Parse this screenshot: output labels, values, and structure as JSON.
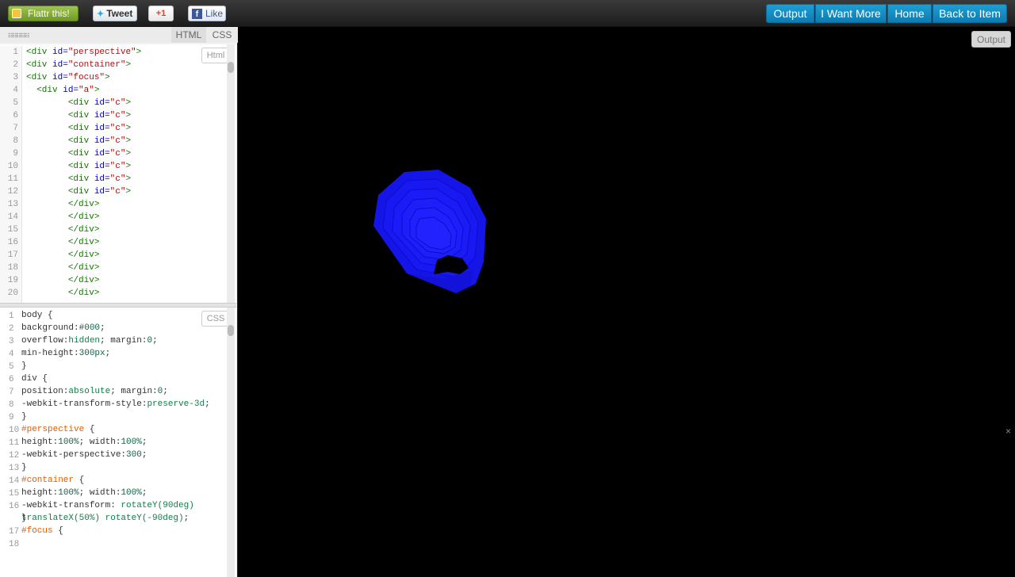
{
  "topbar": {
    "flattr_label": "Flattr this!",
    "tweet_label": "Tweet",
    "gplus_label": "+1",
    "fblike_label": "Like",
    "nav": [
      "Output",
      "I Want More",
      "Home",
      "Back to Item"
    ]
  },
  "editor": {
    "tabs": {
      "html": "HTML",
      "css": "CSS"
    },
    "html_badge": "Html",
    "css_badge": "CSS"
  },
  "html_code": [
    {
      "n": "1",
      "t": [
        [
          "tg",
          "<div "
        ],
        [
          "at",
          "id="
        ],
        [
          "st",
          "\"perspective\""
        ],
        [
          "tg",
          ">"
        ]
      ]
    },
    {
      "n": "2",
      "t": [
        [
          "tg",
          "<div "
        ],
        [
          "at",
          "id="
        ],
        [
          "st",
          "\"container\""
        ],
        [
          "tg",
          ">"
        ]
      ]
    },
    {
      "n": "3",
      "t": [
        [
          "tg",
          "<div "
        ],
        [
          "at",
          "id="
        ],
        [
          "st",
          "\"focus\""
        ],
        [
          "tg",
          ">"
        ]
      ]
    },
    {
      "n": "4",
      "t": [
        [
          "pr",
          "  "
        ],
        [
          "tg",
          "<div "
        ],
        [
          "at",
          "id="
        ],
        [
          "st",
          "\"a\""
        ],
        [
          "tg",
          ">"
        ]
      ]
    },
    {
      "n": "5",
      "t": [
        [
          "pr",
          "        "
        ],
        [
          "tg",
          "<div "
        ],
        [
          "at",
          "id="
        ],
        [
          "st",
          "\"c\""
        ],
        [
          "tg",
          ">"
        ]
      ]
    },
    {
      "n": "6",
      "t": [
        [
          "pr",
          "        "
        ],
        [
          "tg",
          "<div "
        ],
        [
          "at",
          "id="
        ],
        [
          "st",
          "\"c\""
        ],
        [
          "tg",
          ">"
        ]
      ]
    },
    {
      "n": "7",
      "t": [
        [
          "pr",
          "        "
        ],
        [
          "tg",
          "<div "
        ],
        [
          "at",
          "id="
        ],
        [
          "st",
          "\"c\""
        ],
        [
          "tg",
          ">"
        ]
      ]
    },
    {
      "n": "8",
      "t": [
        [
          "pr",
          "        "
        ],
        [
          "tg",
          "<div "
        ],
        [
          "at",
          "id="
        ],
        [
          "st",
          "\"c\""
        ],
        [
          "tg",
          ">"
        ]
      ]
    },
    {
      "n": "9",
      "t": [
        [
          "pr",
          "        "
        ],
        [
          "tg",
          "<div "
        ],
        [
          "at",
          "id="
        ],
        [
          "st",
          "\"c\""
        ],
        [
          "tg",
          ">"
        ]
      ]
    },
    {
      "n": "10",
      "t": [
        [
          "pr",
          "        "
        ],
        [
          "tg",
          "<div "
        ],
        [
          "at",
          "id="
        ],
        [
          "st",
          "\"c\""
        ],
        [
          "tg",
          ">"
        ]
      ]
    },
    {
      "n": "11",
      "t": [
        [
          "pr",
          "        "
        ],
        [
          "tg",
          "<div "
        ],
        [
          "at",
          "id="
        ],
        [
          "st",
          "\"c\""
        ],
        [
          "tg",
          ">"
        ]
      ]
    },
    {
      "n": "12",
      "t": [
        [
          "pr",
          "        "
        ],
        [
          "tg",
          "<div "
        ],
        [
          "at",
          "id="
        ],
        [
          "st",
          "\"c\""
        ],
        [
          "tg",
          ">"
        ]
      ]
    },
    {
      "n": "13",
      "t": [
        [
          "pr",
          "        "
        ],
        [
          "tg",
          "</div>"
        ]
      ]
    },
    {
      "n": "14",
      "t": [
        [
          "pr",
          "        "
        ],
        [
          "tg",
          "</div>"
        ]
      ]
    },
    {
      "n": "15",
      "t": [
        [
          "pr",
          "        "
        ],
        [
          "tg",
          "</div>"
        ]
      ]
    },
    {
      "n": "16",
      "t": [
        [
          "pr",
          "        "
        ],
        [
          "tg",
          "</div>"
        ]
      ]
    },
    {
      "n": "17",
      "t": [
        [
          "pr",
          "        "
        ],
        [
          "tg",
          "</div>"
        ]
      ]
    },
    {
      "n": "18",
      "t": [
        [
          "pr",
          "        "
        ],
        [
          "tg",
          "</div>"
        ]
      ]
    },
    {
      "n": "19",
      "t": [
        [
          "pr",
          "        "
        ],
        [
          "tg",
          "</div>"
        ]
      ]
    },
    {
      "n": "20",
      "t": [
        [
          "pr",
          "        "
        ],
        [
          "tg",
          "</div>"
        ]
      ]
    }
  ],
  "css_code": [
    {
      "n": "1",
      "t": [
        [
          "pr",
          "body {"
        ]
      ]
    },
    {
      "n": "2",
      "t": [
        [
          "pr",
          "  background:"
        ],
        [
          "nm",
          "#000"
        ],
        [
          "pr",
          ";"
        ]
      ]
    },
    {
      "n": "3",
      "t": [
        [
          "pr",
          "  overflow:"
        ],
        [
          "vl",
          "hidden"
        ],
        [
          "pr",
          "; margin:"
        ],
        [
          "nm",
          "0"
        ],
        [
          "pr",
          ";"
        ]
      ]
    },
    {
      "n": "4",
      "t": [
        [
          "pr",
          "  min-height:"
        ],
        [
          "nm",
          "300px"
        ],
        [
          "pr",
          ";"
        ]
      ]
    },
    {
      "n": "5",
      "t": [
        [
          "pr",
          "}"
        ]
      ]
    },
    {
      "n": "6",
      "t": [
        [
          "pr",
          "div {"
        ]
      ]
    },
    {
      "n": "7",
      "t": [
        [
          "pr",
          "  position:"
        ],
        [
          "vl",
          "absolute"
        ],
        [
          "pr",
          "; margin:"
        ],
        [
          "nm",
          "0"
        ],
        [
          "pr",
          ";"
        ]
      ]
    },
    {
      "n": "8",
      "t": [
        [
          "pr",
          "  -webkit-transform-style:"
        ],
        [
          "vl",
          "preserve-3d"
        ],
        [
          "pr",
          ";"
        ]
      ]
    },
    {
      "n": "9",
      "t": [
        [
          "pr",
          "}"
        ]
      ]
    },
    {
      "n": "10",
      "t": [
        [
          "sel",
          "#perspective"
        ],
        [
          "pr",
          " {"
        ]
      ]
    },
    {
      "n": "11",
      "t": [
        [
          "pr",
          "  height:"
        ],
        [
          "nm",
          "100%"
        ],
        [
          "pr",
          "; width:"
        ],
        [
          "nm",
          "100%"
        ],
        [
          "pr",
          ";"
        ]
      ]
    },
    {
      "n": "12",
      "t": [
        [
          "pr",
          "  -webkit-perspective:"
        ],
        [
          "nm",
          "300"
        ],
        [
          "pr",
          ";"
        ]
      ]
    },
    {
      "n": "13",
      "t": [
        [
          "pr",
          "}"
        ]
      ]
    },
    {
      "n": "14",
      "t": [
        [
          "sel",
          "#container"
        ],
        [
          "pr",
          " {"
        ]
      ]
    },
    {
      "n": "15",
      "t": [
        [
          "pr",
          "  height:"
        ],
        [
          "nm",
          "100%"
        ],
        [
          "pr",
          "; width:"
        ],
        [
          "nm",
          "100%"
        ],
        [
          "pr",
          ";"
        ]
      ]
    },
    {
      "n": "16",
      "t": [
        [
          "pr",
          "  -webkit-transform: "
        ],
        [
          "vl",
          "rotateY(90deg) translateX(50%) rotateY(-90deg)"
        ],
        [
          "pr",
          ";"
        ]
      ]
    },
    {
      "n": "17",
      "t": [
        [
          "pr",
          "}"
        ]
      ]
    },
    {
      "n": "18",
      "t": [
        [
          "sel",
          "#focus"
        ],
        [
          "pr",
          " {"
        ]
      ]
    }
  ],
  "output": {
    "label": "Output",
    "close": "×"
  },
  "colors": {
    "accent": "#1490c9",
    "shape": "#1a1aff"
  }
}
